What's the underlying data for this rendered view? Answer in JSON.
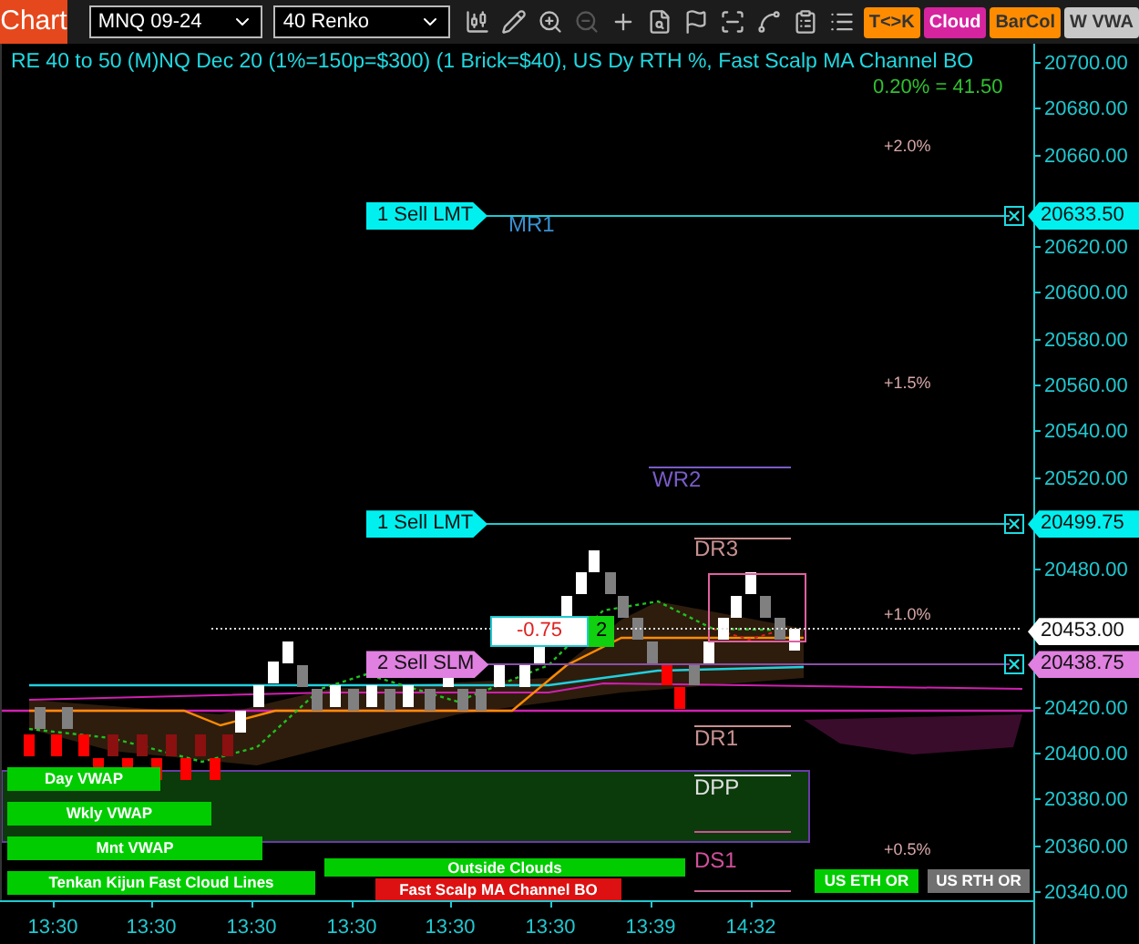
{
  "toolbar": {
    "tab": "Chart",
    "instrument": "MNQ 09-24",
    "bar_type": "40 Renko",
    "buttons": [
      {
        "label": "T<>K",
        "color": "#ff8c00"
      },
      {
        "label": "Cloud",
        "color": "#d6249f"
      },
      {
        "label": "BarCol",
        "color": "#ff8c00"
      },
      {
        "label": "W VWA",
        "color": "#c8c8c8"
      }
    ]
  },
  "chart": {
    "title": "RE 40 to 50 (M)NQ Dec 20 (1%=150p=$300) (1 Brick=$40), US Dy RTH %, Fast Scalp MA Channel BO",
    "range_label": "0.20% = 41.50",
    "percent_levels": [
      "+2.0%",
      "+1.5%",
      "+1.0%",
      "+0.5%"
    ],
    "pivots": [
      {
        "label": "MR1",
        "color": "#3a8fd0"
      },
      {
        "label": "WR2",
        "color": "#7a5cc8"
      },
      {
        "label": "DR3",
        "color": "#c89090"
      },
      {
        "label": "DR1",
        "color": "#c89090"
      },
      {
        "label": "DPP",
        "color": "#e0e0e0"
      },
      {
        "label": "DS1",
        "color": "#d0509a"
      }
    ],
    "orders": [
      {
        "label": "1 Sell LMT",
        "price": "20633.50",
        "kind": "limit"
      },
      {
        "label": "1 Sell LMT",
        "price": "20499.75",
        "kind": "limit"
      },
      {
        "label": "2 Sell SLM",
        "price": "20438.75",
        "kind": "stop"
      }
    ],
    "position": {
      "pnl": "-0.75",
      "quantity": "2",
      "price": "20453.00"
    },
    "indicator_labels": [
      {
        "label": "Day VWAP",
        "color": "#00cc00"
      },
      {
        "label": "Wkly VWAP",
        "color": "#00cc00"
      },
      {
        "label": "Mnt VWAP",
        "color": "#00cc00"
      },
      {
        "label": "Tenkan Kijun Fast Cloud Lines",
        "color": "#00cc00"
      },
      {
        "label": "Outside Clouds",
        "color": "#00cc00"
      },
      {
        "label": "Fast Scalp MA Channel BO",
        "color": "#dd1111"
      },
      {
        "label": "US ETH OR",
        "color": "#00cc00"
      },
      {
        "label": "US RTH OR",
        "color": "#707070"
      }
    ],
    "price_axis": [
      "20700.00",
      "20680.00",
      "20660.00",
      "20620.00",
      "20600.00",
      "20580.00",
      "20560.00",
      "20540.00",
      "20520.00",
      "20480.00",
      "20420.00",
      "20400.00",
      "20380.00",
      "20360.00",
      "20340.00"
    ],
    "time_axis": [
      "13:30",
      "13:30",
      "13:30",
      "13:30",
      "13:30",
      "13:30",
      "13:39",
      "14:32"
    ]
  }
}
